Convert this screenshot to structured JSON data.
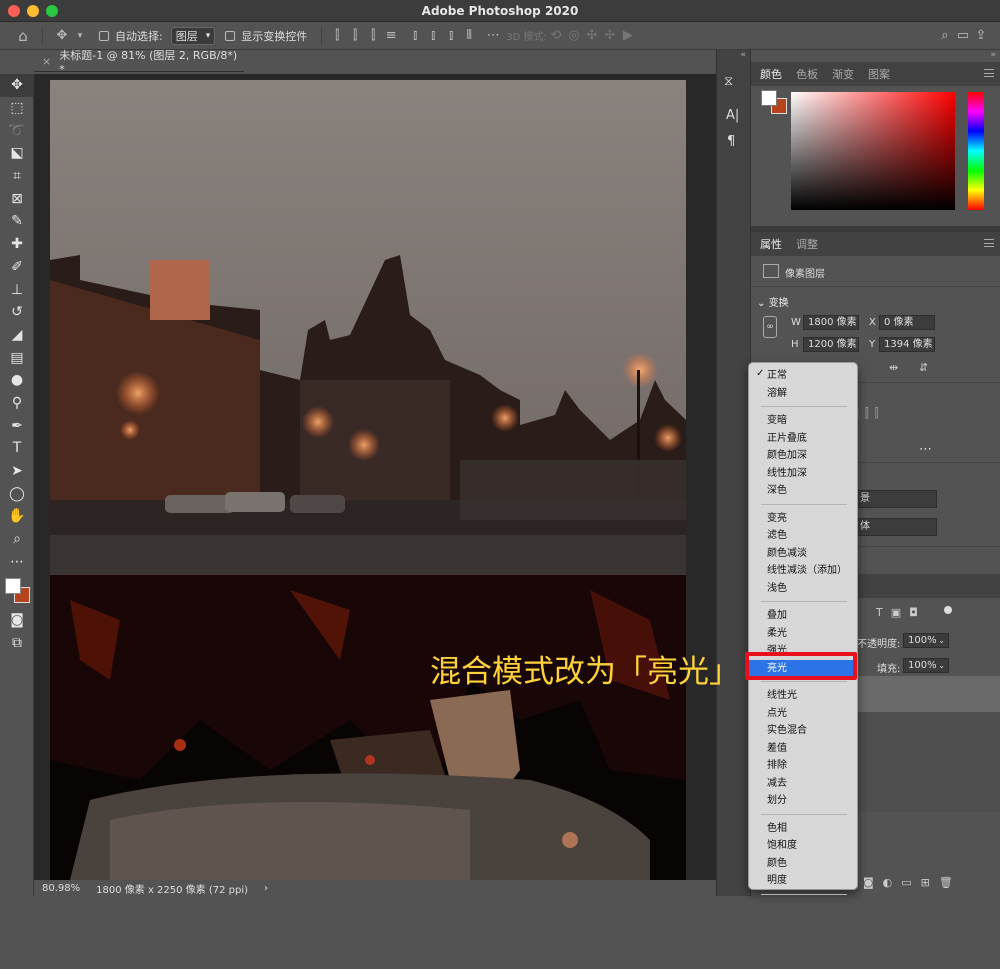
{
  "window": {
    "title": "Adobe Photoshop 2020"
  },
  "options_bar": {
    "auto_select_label": "自动选择:",
    "layer_select": "图层",
    "show_transform_label": "显示变换控件",
    "mode_3d_label": "3D 模式:"
  },
  "document": {
    "tab_title": "未标题-1 @ 81% (图层 2, RGB/8*) *",
    "zoom": "80.98%",
    "doc_info": "1800 像素 x 2250 像素 (72 ppi)"
  },
  "color_panel": {
    "tabs": [
      "颜色",
      "色板",
      "渐变",
      "图案"
    ],
    "foreground": "#ffffff",
    "background": "#b5431c"
  },
  "properties_panel": {
    "tabs": [
      "属性",
      "调整"
    ],
    "layer_type": "像素图层",
    "transform_label": "变换",
    "w_label": "W",
    "w_value": "1800 像素",
    "h_label": "H",
    "h_value": "1200 像素",
    "x_label": "X",
    "x_value": "0 像素",
    "y_label": "Y",
    "y_value": "1394 像素",
    "partial_label_1": "景",
    "partial_label_2": "体"
  },
  "layers_panel": {
    "opacity_label": "不透明度:",
    "opacity_value": "100%",
    "fill_label": "填充:",
    "fill_value": "100%"
  },
  "blend_menu": {
    "selected": "亮光",
    "items": [
      "正常",
      "溶解",
      "变暗",
      "正片叠底",
      "颜色加深",
      "线性加深",
      "深色",
      "变亮",
      "滤色",
      "颜色减淡",
      "线性减淡（添加）",
      "浅色",
      "叠加",
      "柔光",
      "强光",
      "亮光",
      "线性光",
      "点光",
      "实色混合",
      "差值",
      "排除",
      "减去",
      "划分",
      "色相",
      "饱和度",
      "颜色",
      "明度"
    ]
  },
  "annotation": {
    "caption": "混合模式改为「亮光」",
    "box_color": "#e8101c",
    "caption_color": "#ffd23a"
  }
}
